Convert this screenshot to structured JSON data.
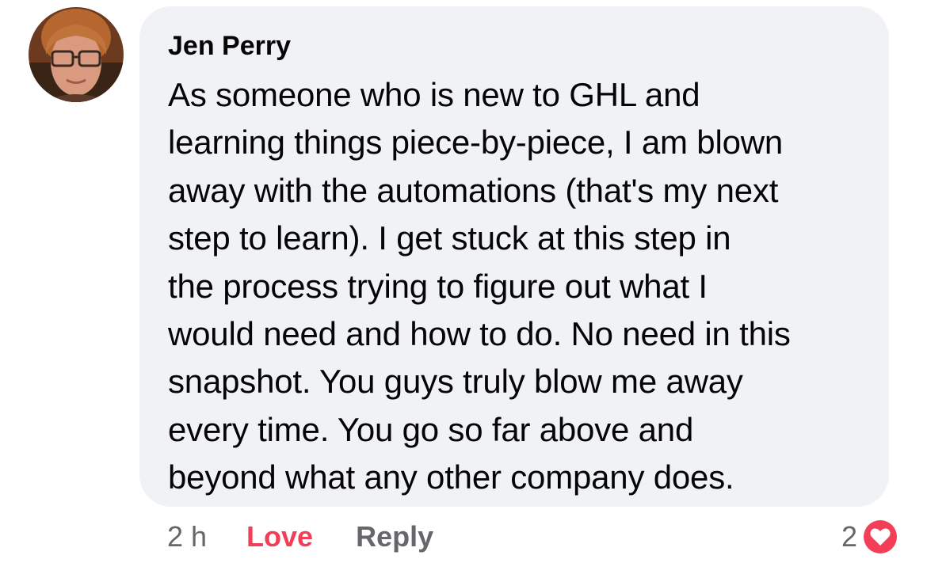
{
  "comment": {
    "author": "Jen Perry",
    "text": "As someone who is new to GHL and\nlearning things piece-by-piece, I am blown\naway with the automations (that's my next\nstep to learn). I get stuck  at this step in\nthe process trying to figure out what I\nwould need and how to do. No need in this\nsnapshot. You guys truly blow me away\nevery time. You go so far above and\nbeyond what any other company does."
  },
  "meta": {
    "timestamp": "2 h",
    "love_label": "Love",
    "reply_label": "Reply"
  },
  "reactions": {
    "count": "2",
    "icon": "heart-icon"
  },
  "colors": {
    "bubble_bg": "#f0f2f5",
    "love": "#f33e58",
    "meta_text": "#65676b",
    "text": "#050505"
  }
}
